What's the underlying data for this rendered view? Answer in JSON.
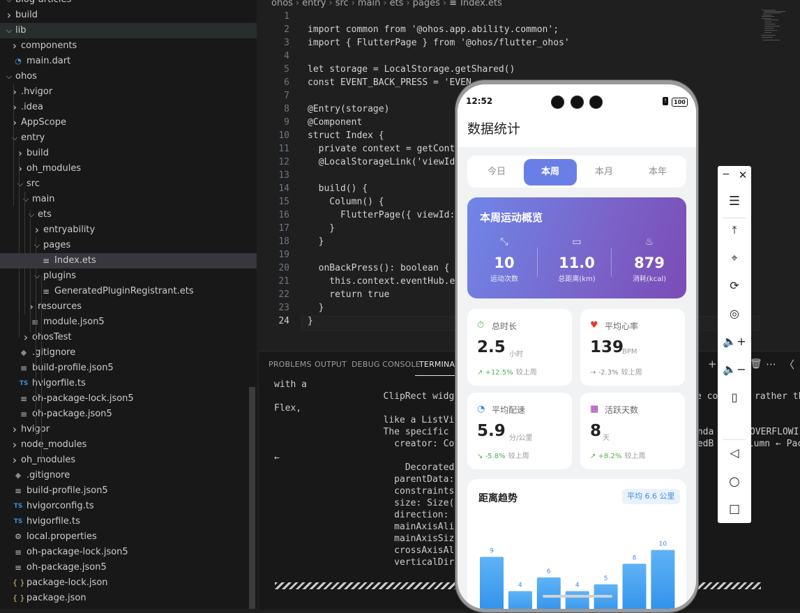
{
  "explorer": {
    "items": [
      {
        "label": "blog-articles",
        "depth": 0,
        "chevron": "down",
        "icon": ""
      },
      {
        "label": "build",
        "depth": 0,
        "chevron": "right",
        "icon": ""
      },
      {
        "label": "lib",
        "depth": 0,
        "chevron": "down",
        "icon": "",
        "state": "hover"
      },
      {
        "label": "components",
        "depth": 1,
        "chevron": "right",
        "icon": ""
      },
      {
        "label": "main.dart",
        "depth": 1,
        "chevron": "",
        "icon": "dart-icon"
      },
      {
        "label": "ohos",
        "depth": 0,
        "chevron": "down",
        "icon": ""
      },
      {
        "label": ".hvigor",
        "depth": 1,
        "chevron": "right",
        "icon": ""
      },
      {
        "label": ".idea",
        "depth": 1,
        "chevron": "right",
        "icon": ""
      },
      {
        "label": "AppScope",
        "depth": 1,
        "chevron": "right",
        "icon": ""
      },
      {
        "label": "entry",
        "depth": 1,
        "chevron": "down",
        "icon": ""
      },
      {
        "label": "build",
        "depth": 2,
        "chevron": "right",
        "icon": ""
      },
      {
        "label": "oh_modules",
        "depth": 2,
        "chevron": "right",
        "icon": ""
      },
      {
        "label": "src",
        "depth": 2,
        "chevron": "down",
        "icon": ""
      },
      {
        "label": "main",
        "depth": 3,
        "chevron": "down",
        "icon": ""
      },
      {
        "label": "ets",
        "depth": 4,
        "chevron": "down",
        "icon": ""
      },
      {
        "label": "entryability",
        "depth": 5,
        "chevron": "right",
        "icon": ""
      },
      {
        "label": "pages",
        "depth": 5,
        "chevron": "down",
        "icon": ""
      },
      {
        "label": "Index.ets",
        "depth": 6,
        "chevron": "",
        "icon": "lines-icon",
        "state": "selected"
      },
      {
        "label": "plugins",
        "depth": 5,
        "chevron": "down",
        "icon": ""
      },
      {
        "label": "GeneratedPluginRegistrant.ets",
        "depth": 6,
        "chevron": "",
        "icon": "lines-icon"
      },
      {
        "label": "resources",
        "depth": 4,
        "chevron": "right",
        "icon": ""
      },
      {
        "label": "module.json5",
        "depth": 4,
        "chevron": "",
        "icon": "lines-icon"
      },
      {
        "label": "ohosTest",
        "depth": 3,
        "chevron": "right",
        "icon": ""
      },
      {
        "label": ".gitignore",
        "depth": 2,
        "chevron": "",
        "icon": "git-icon"
      },
      {
        "label": "build-profile.json5",
        "depth": 2,
        "chevron": "",
        "icon": "lines-icon"
      },
      {
        "label": "hvigorfile.ts",
        "depth": 2,
        "chevron": "",
        "icon": "ts-icon"
      },
      {
        "label": "oh-package-lock.json5",
        "depth": 2,
        "chevron": "",
        "icon": "lines-icon"
      },
      {
        "label": "oh-package.json5",
        "depth": 2,
        "chevron": "",
        "icon": "lines-icon"
      },
      {
        "label": "hvigor",
        "depth": 1,
        "chevron": "right",
        "icon": ""
      },
      {
        "label": "node_modules",
        "depth": 1,
        "chevron": "right",
        "icon": ""
      },
      {
        "label": "oh_modules",
        "depth": 1,
        "chevron": "right",
        "icon": ""
      },
      {
        "label": ".gitignore",
        "depth": 1,
        "chevron": "",
        "icon": "git-icon"
      },
      {
        "label": "build-profile.json5",
        "depth": 1,
        "chevron": "",
        "icon": "lines-icon"
      },
      {
        "label": "hvigorconfig.ts",
        "depth": 1,
        "chevron": "",
        "icon": "ts-icon"
      },
      {
        "label": "hvigorfile.ts",
        "depth": 1,
        "chevron": "",
        "icon": "ts-icon"
      },
      {
        "label": "local.properties",
        "depth": 1,
        "chevron": "",
        "icon": "gear-icon"
      },
      {
        "label": "oh-package-lock.json5",
        "depth": 1,
        "chevron": "",
        "icon": "lines-icon"
      },
      {
        "label": "oh-package.json5",
        "depth": 1,
        "chevron": "",
        "icon": "lines-icon"
      },
      {
        "label": "package-lock.json",
        "depth": 1,
        "chevron": "",
        "icon": "json-icon"
      },
      {
        "label": "package.json",
        "depth": 1,
        "chevron": "",
        "icon": "json-icon"
      }
    ]
  },
  "editor": {
    "breadcrumb": [
      "ohos",
      "entry",
      "src",
      "main",
      "ets",
      "pages",
      "Index.ets"
    ],
    "lines": [
      {
        "n": "1",
        "text": ""
      },
      {
        "n": "2",
        "text": "import common from '@ohos.app.ability.common';"
      },
      {
        "n": "3",
        "text": "import { FlutterPage } from '@ohos/flutter_ohos'"
      },
      {
        "n": "4",
        "text": ""
      },
      {
        "n": "5",
        "text": "let storage = LocalStorage.getShared()"
      },
      {
        "n": "6",
        "text": "const EVENT_BACK_PRESS = 'EVEN"
      },
      {
        "n": "7",
        "text": ""
      },
      {
        "n": "8",
        "text": "@Entry(storage)"
      },
      {
        "n": "9",
        "text": "@Component"
      },
      {
        "n": "10",
        "text": "struct Index {"
      },
      {
        "n": "11",
        "text": "  private context = getConte"
      },
      {
        "n": "12",
        "text": "  @LocalStorageLink('viewId"
      },
      {
        "n": "13",
        "text": ""
      },
      {
        "n": "14",
        "text": "  build() {"
      },
      {
        "n": "15",
        "text": "    Column() {"
      },
      {
        "n": "16",
        "text": "      FlutterPage({ viewId:"
      },
      {
        "n": "17",
        "text": "    }"
      },
      {
        "n": "18",
        "text": "  }"
      },
      {
        "n": "19",
        "text": ""
      },
      {
        "n": "20",
        "text": "  onBackPress(): boolean {"
      },
      {
        "n": "21",
        "text": "    this.context.eventHub.em"
      },
      {
        "n": "22",
        "text": "    return true"
      },
      {
        "n": "23",
        "text": "  }"
      },
      {
        "n": "24",
        "text": "}"
      }
    ]
  },
  "panel": {
    "tabs": [
      "PROBLEMS",
      "OUTPUT",
      "DEBUG CONSOLE",
      "TERMINAL"
    ],
    "active_tab": "TERMINAL",
    "lines": [
      "with a",
      "                    ClipRect widget b",
      "Flex,",
      "                    like a ListView.",
      "                    The specific Rend",
      "                      creator: Column",
      "←",
      "                        DecoratedBox",
      "                      parentData: off",
      "                      constraints: Bo",
      "                      size: Size(38.2",
      "                      direction: vert",
      "                      mainAxisAlignme",
      "                      mainAxisSize: m",
      "                      crossAxisAlignm",
      "                      verticalDirecti"
    ],
    "right_fragments": [
      "e co",
      "rather th",
      "unda",
      "OVERFLOWI",
      "zedB",
      "olumn ← Pac"
    ]
  },
  "phone": {
    "time": "12:52",
    "battery": "100",
    "title": "数据统计",
    "tabs": [
      "今日",
      "本周",
      "本月",
      "本年"
    ],
    "active_tab_index": 1,
    "overview": {
      "title": "本周运动概览",
      "stats": [
        {
          "value": "10",
          "label": "运动次数",
          "icon": "expand-arrows-icon"
        },
        {
          "value": "11.0",
          "label": "总距离(km)",
          "icon": "ruler-icon"
        },
        {
          "value": "879",
          "label": "消耗(kcal)",
          "icon": "flame-icon"
        }
      ]
    },
    "cards": [
      {
        "title": "总时长",
        "value": "2.5",
        "unit": "小时",
        "trend": "+12.5%",
        "compare": "较上周",
        "icon": "stopwatch-icon",
        "icon_color": "#4caf50",
        "trend_dir": "up",
        "trend_color": "#4caf50"
      },
      {
        "title": "平均心率",
        "value": "139",
        "unit": "BPM",
        "trend": "-2.3%",
        "compare": "较上周",
        "icon": "heart-icon",
        "icon_color": "#e53935",
        "trend_dir": "flat",
        "trend_color": "#888888"
      },
      {
        "title": "平均配速",
        "value": "5.9",
        "unit": "分/公里",
        "trend": "-5.8%",
        "compare": "较上周",
        "icon": "gauge-icon",
        "icon_color": "#3d8ce6",
        "trend_dir": "down",
        "trend_color": "#4caf50"
      },
      {
        "title": "活跃天数",
        "value": "8",
        "unit": "天",
        "trend": "+8.2%",
        "compare": "较上周",
        "icon": "calendar-icon",
        "icon_color": "#9c27b0",
        "trend_dir": "up",
        "trend_color": "#4caf50"
      }
    ],
    "trend": {
      "title": "距离趋势",
      "badge": "平均 6.6 公里"
    }
  },
  "chart_data": {
    "type": "bar",
    "title": "距离趋势",
    "values": [
      9,
      4,
      6,
      4,
      5,
      8,
      10
    ],
    "ylim": [
      0,
      12
    ]
  },
  "sidebar": {
    "icons": [
      "minimize-icon",
      "close-icon",
      "menu-icon",
      "pin-top-icon",
      "crop-icon",
      "rotate-icon",
      "screenshot-icon",
      "volume-up-icon",
      "volume-down-icon",
      "shake-icon",
      "back-icon",
      "home-icon",
      "recents-icon"
    ]
  },
  "colors": {
    "accent": "#6a7fe6",
    "bar": "#3d9cf0",
    "selected_row": "#37373d"
  }
}
